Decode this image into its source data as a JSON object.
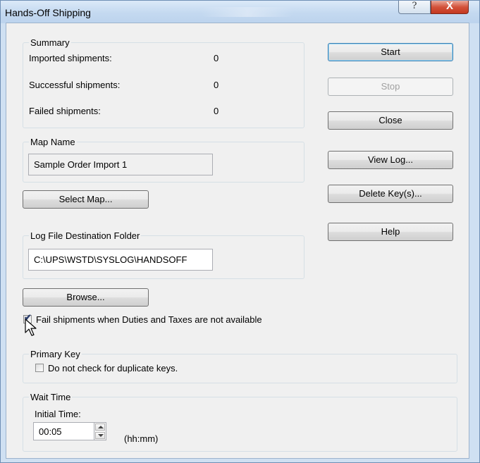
{
  "window": {
    "title": "Hands-Off Shipping",
    "help_glyph": "?",
    "close_glyph": "X"
  },
  "summary": {
    "title": "Summary",
    "imported_label": "Imported shipments:",
    "imported_value": "0",
    "successful_label": "Successful shipments:",
    "successful_value": "0",
    "failed_label": "Failed shipments:",
    "failed_value": "0"
  },
  "map_name": {
    "title": "Map Name",
    "value": "Sample Order Import 1"
  },
  "select_map_label": "Select Map...",
  "log_folder": {
    "title": "Log File Destination Folder",
    "value": "C:\\UPS\\WSTD\\SYSLOG\\HANDSOFF"
  },
  "browse_label": "Browse...",
  "fail_duties": {
    "label": "Fail shipments when Duties and Taxes are not available",
    "checked": true
  },
  "primary_key": {
    "title": "Primary Key",
    "no_dup_label": "Do not check for duplicate keys.",
    "checked": false
  },
  "wait_time": {
    "title": "Wait Time",
    "initial_label": "Initial Time:",
    "value": "00:05",
    "unit": "(hh:mm)"
  },
  "side_buttons": {
    "start": "Start",
    "stop": "Stop",
    "close": "Close",
    "view_log": "View Log...",
    "delete_keys": "Delete Key(s)...",
    "help": "Help"
  },
  "icons": {
    "checkmark": "check-icon",
    "cursor": "mouse-pointer-icon",
    "spin_up": "spin-up-arrow-icon",
    "spin_down": "spin-down-arrow-icon"
  },
  "colors": {
    "title_gradient_top": "#dbe9f8",
    "close_button_red": "#c4371f",
    "dialog_background": "#f0f0f0",
    "default_button_border": "#3c7fb1"
  }
}
